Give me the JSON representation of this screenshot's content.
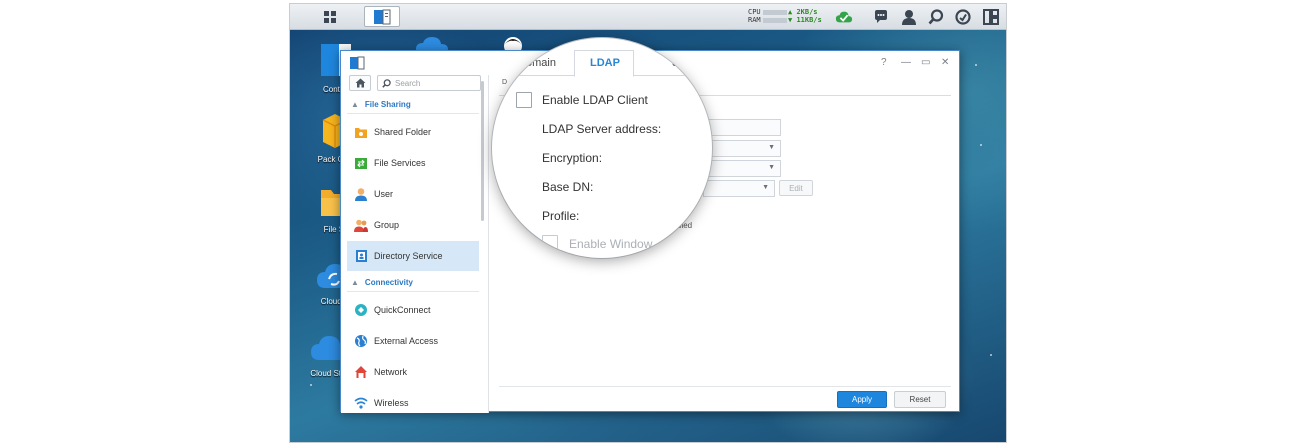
{
  "taskbar": {
    "cpu_label": "CPU",
    "ram_label": "RAM",
    "upload_speed": "2KB/s",
    "download_speed": "11KB/s"
  },
  "desktop_icons": [
    {
      "label": "Contro"
    },
    {
      "label": "Pack Cen"
    },
    {
      "label": "File St"
    },
    {
      "label": "Cloud S"
    },
    {
      "label": "Cloud Stat"
    }
  ],
  "window": {
    "controls": {
      "help": "?",
      "minimize": "—",
      "maximize": "▭",
      "close": "✕"
    },
    "search_placeholder": "Search",
    "sections": {
      "file_sharing": "File Sharing",
      "connectivity": "Connectivity"
    },
    "nav": [
      {
        "label": "Shared Folder",
        "icon": "shared-folder-icon",
        "color": "#f2a321"
      },
      {
        "label": "File Services",
        "icon": "file-services-icon",
        "color": "#3aab3a"
      },
      {
        "label": "User",
        "icon": "user-icon",
        "color": "#e5a050"
      },
      {
        "label": "Group",
        "icon": "group-icon",
        "color": "#e5a050"
      },
      {
        "label": "Directory Service",
        "icon": "directory-service-icon",
        "color": "#2a7fd0",
        "active": true
      },
      {
        "label": "QuickConnect",
        "icon": "quickconnect-icon",
        "color": "#2bb3c4"
      },
      {
        "label": "External Access",
        "icon": "external-access-icon",
        "color": "#2a7fd0"
      },
      {
        "label": "Network",
        "icon": "network-icon",
        "color": "#e0453a"
      },
      {
        "label": "Wireless",
        "icon": "wireless-icon",
        "color": "#2a86d4"
      }
    ],
    "content": {
      "tab_fragment": "D",
      "bled_text": "bled",
      "edit_button": "Edit",
      "apply_button": "Apply",
      "reset_button": "Reset"
    }
  },
  "magnifier": {
    "tabs": {
      "domain": "omain",
      "ldap": "LDAP",
      "partial": "el"
    },
    "enable_ldap_client": "Enable LDAP Client",
    "ldap_server_address": "LDAP Server address:",
    "encryption": "Encryption:",
    "base_dn": "Base DN:",
    "profile": "Profile:",
    "enable_windows": "Enable Window"
  },
  "colors": {
    "accent": "#2a86d4",
    "apply": "#1f86dd",
    "active_nav": "#d6e8f7"
  }
}
